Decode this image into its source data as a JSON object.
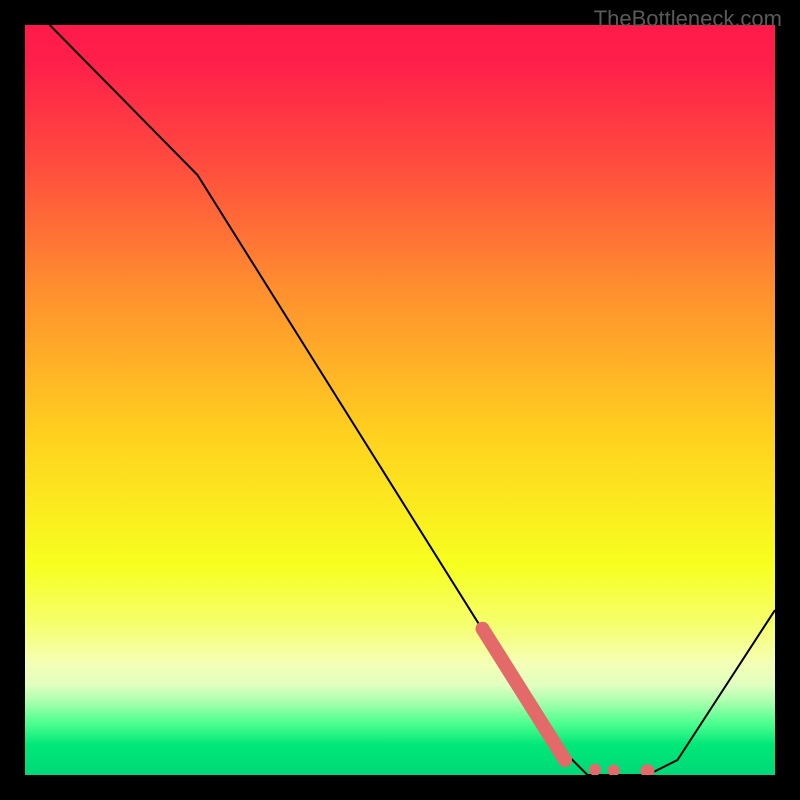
{
  "watermark": "TheBottleneck.com",
  "chart_data": {
    "type": "line",
    "title": "",
    "xlabel": "",
    "ylabel": "",
    "xlim": [
      0,
      100
    ],
    "ylim": [
      0,
      100
    ],
    "grid": false,
    "series": [
      {
        "name": "curve",
        "style": "thin-black",
        "x": [
          3.3,
          23,
          70,
          75,
          83,
          87,
          100
        ],
        "y": [
          100,
          80,
          5,
          0,
          0,
          2,
          22
        ]
      },
      {
        "name": "highlight-thick",
        "style": "thick-salmon",
        "x": [
          61,
          72
        ],
        "y": [
          19.5,
          2
        ]
      }
    ],
    "highlight_dots": {
      "style": "salmon-dot",
      "x": [
        72,
        76,
        78.5,
        83
      ],
      "y": [
        2,
        0.7,
        0.6,
        0.5
      ]
    },
    "gradient_stops": [
      {
        "offset": 0.0,
        "color": "#ff1a4a"
      },
      {
        "offset": 0.05,
        "color": "#ff1f4a"
      },
      {
        "offset": 0.18,
        "color": "#ff4a3f"
      },
      {
        "offset": 0.35,
        "color": "#ff8e2f"
      },
      {
        "offset": 0.55,
        "color": "#ffd21f"
      },
      {
        "offset": 0.72,
        "color": "#f7ff1f"
      },
      {
        "offset": 0.8,
        "color": "#f5ff6f"
      },
      {
        "offset": 0.85,
        "color": "#f5ffb5"
      },
      {
        "offset": 0.88,
        "color": "#e0ffc0"
      },
      {
        "offset": 0.9,
        "color": "#b0ffb0"
      },
      {
        "offset": 0.93,
        "color": "#50ff90"
      },
      {
        "offset": 0.96,
        "color": "#00e878"
      },
      {
        "offset": 1.0,
        "color": "#00d878"
      }
    ],
    "colors": {
      "curve": "#000000",
      "highlight": "#e46a6a",
      "background_frame": "#000000"
    }
  }
}
